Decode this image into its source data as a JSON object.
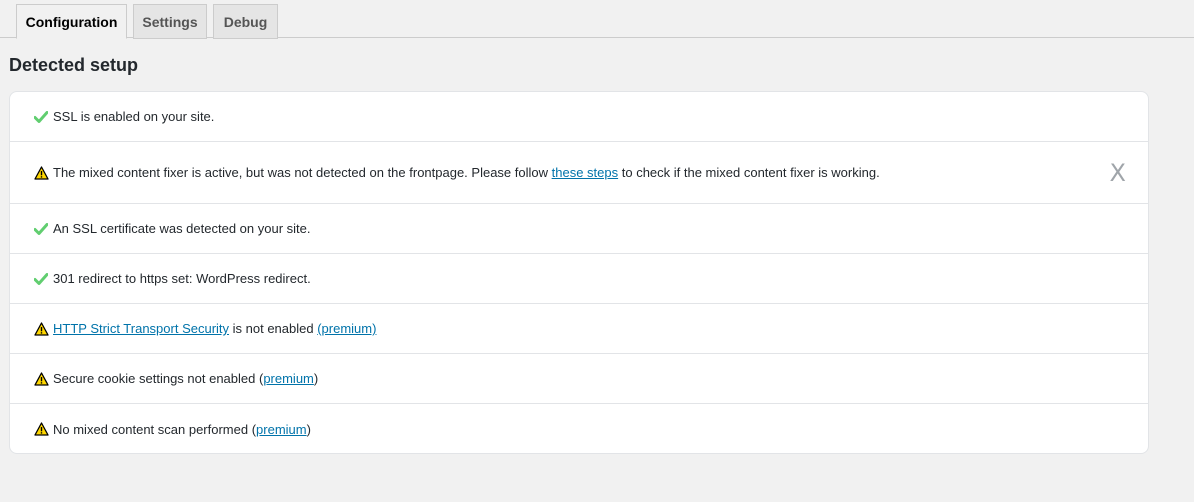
{
  "tabs": [
    {
      "label": "Configuration",
      "active": true
    },
    {
      "label": "Settings",
      "active": false
    },
    {
      "label": "Debug",
      "active": false
    }
  ],
  "section": {
    "title": "Detected setup"
  },
  "items": [
    {
      "status": "success",
      "icon": "checkmark-icon",
      "text": "SSL is enabled on your site."
    },
    {
      "status": "warning",
      "icon": "warning-icon",
      "text_before": "The mixed content fixer is active, but was not detected on the frontpage. Please follow ",
      "link_text": "these steps",
      "text_after": " to check if the mixed content fixer is working.",
      "dismiss_label": "X"
    },
    {
      "status": "success",
      "icon": "checkmark-icon",
      "text": "An SSL certificate was detected on your site."
    },
    {
      "status": "success",
      "icon": "checkmark-icon",
      "text": "301 redirect to https set: WordPress redirect."
    },
    {
      "status": "warning",
      "icon": "warning-icon",
      "link_text": "HTTP Strict Transport Security",
      "text_middle": " is not enabled ",
      "premium_link": "(premium)"
    },
    {
      "status": "warning",
      "icon": "warning-icon",
      "text_before": "Secure cookie settings not enabled (",
      "premium_link": "premium",
      "text_after": ")"
    },
    {
      "status": "warning",
      "icon": "warning-icon",
      "text_before": "No mixed content scan performed (",
      "premium_link": "premium",
      "text_after": ")"
    }
  ],
  "colors": {
    "success": "#61ce70",
    "warning": "#ffd700",
    "link": "#0073aa"
  }
}
